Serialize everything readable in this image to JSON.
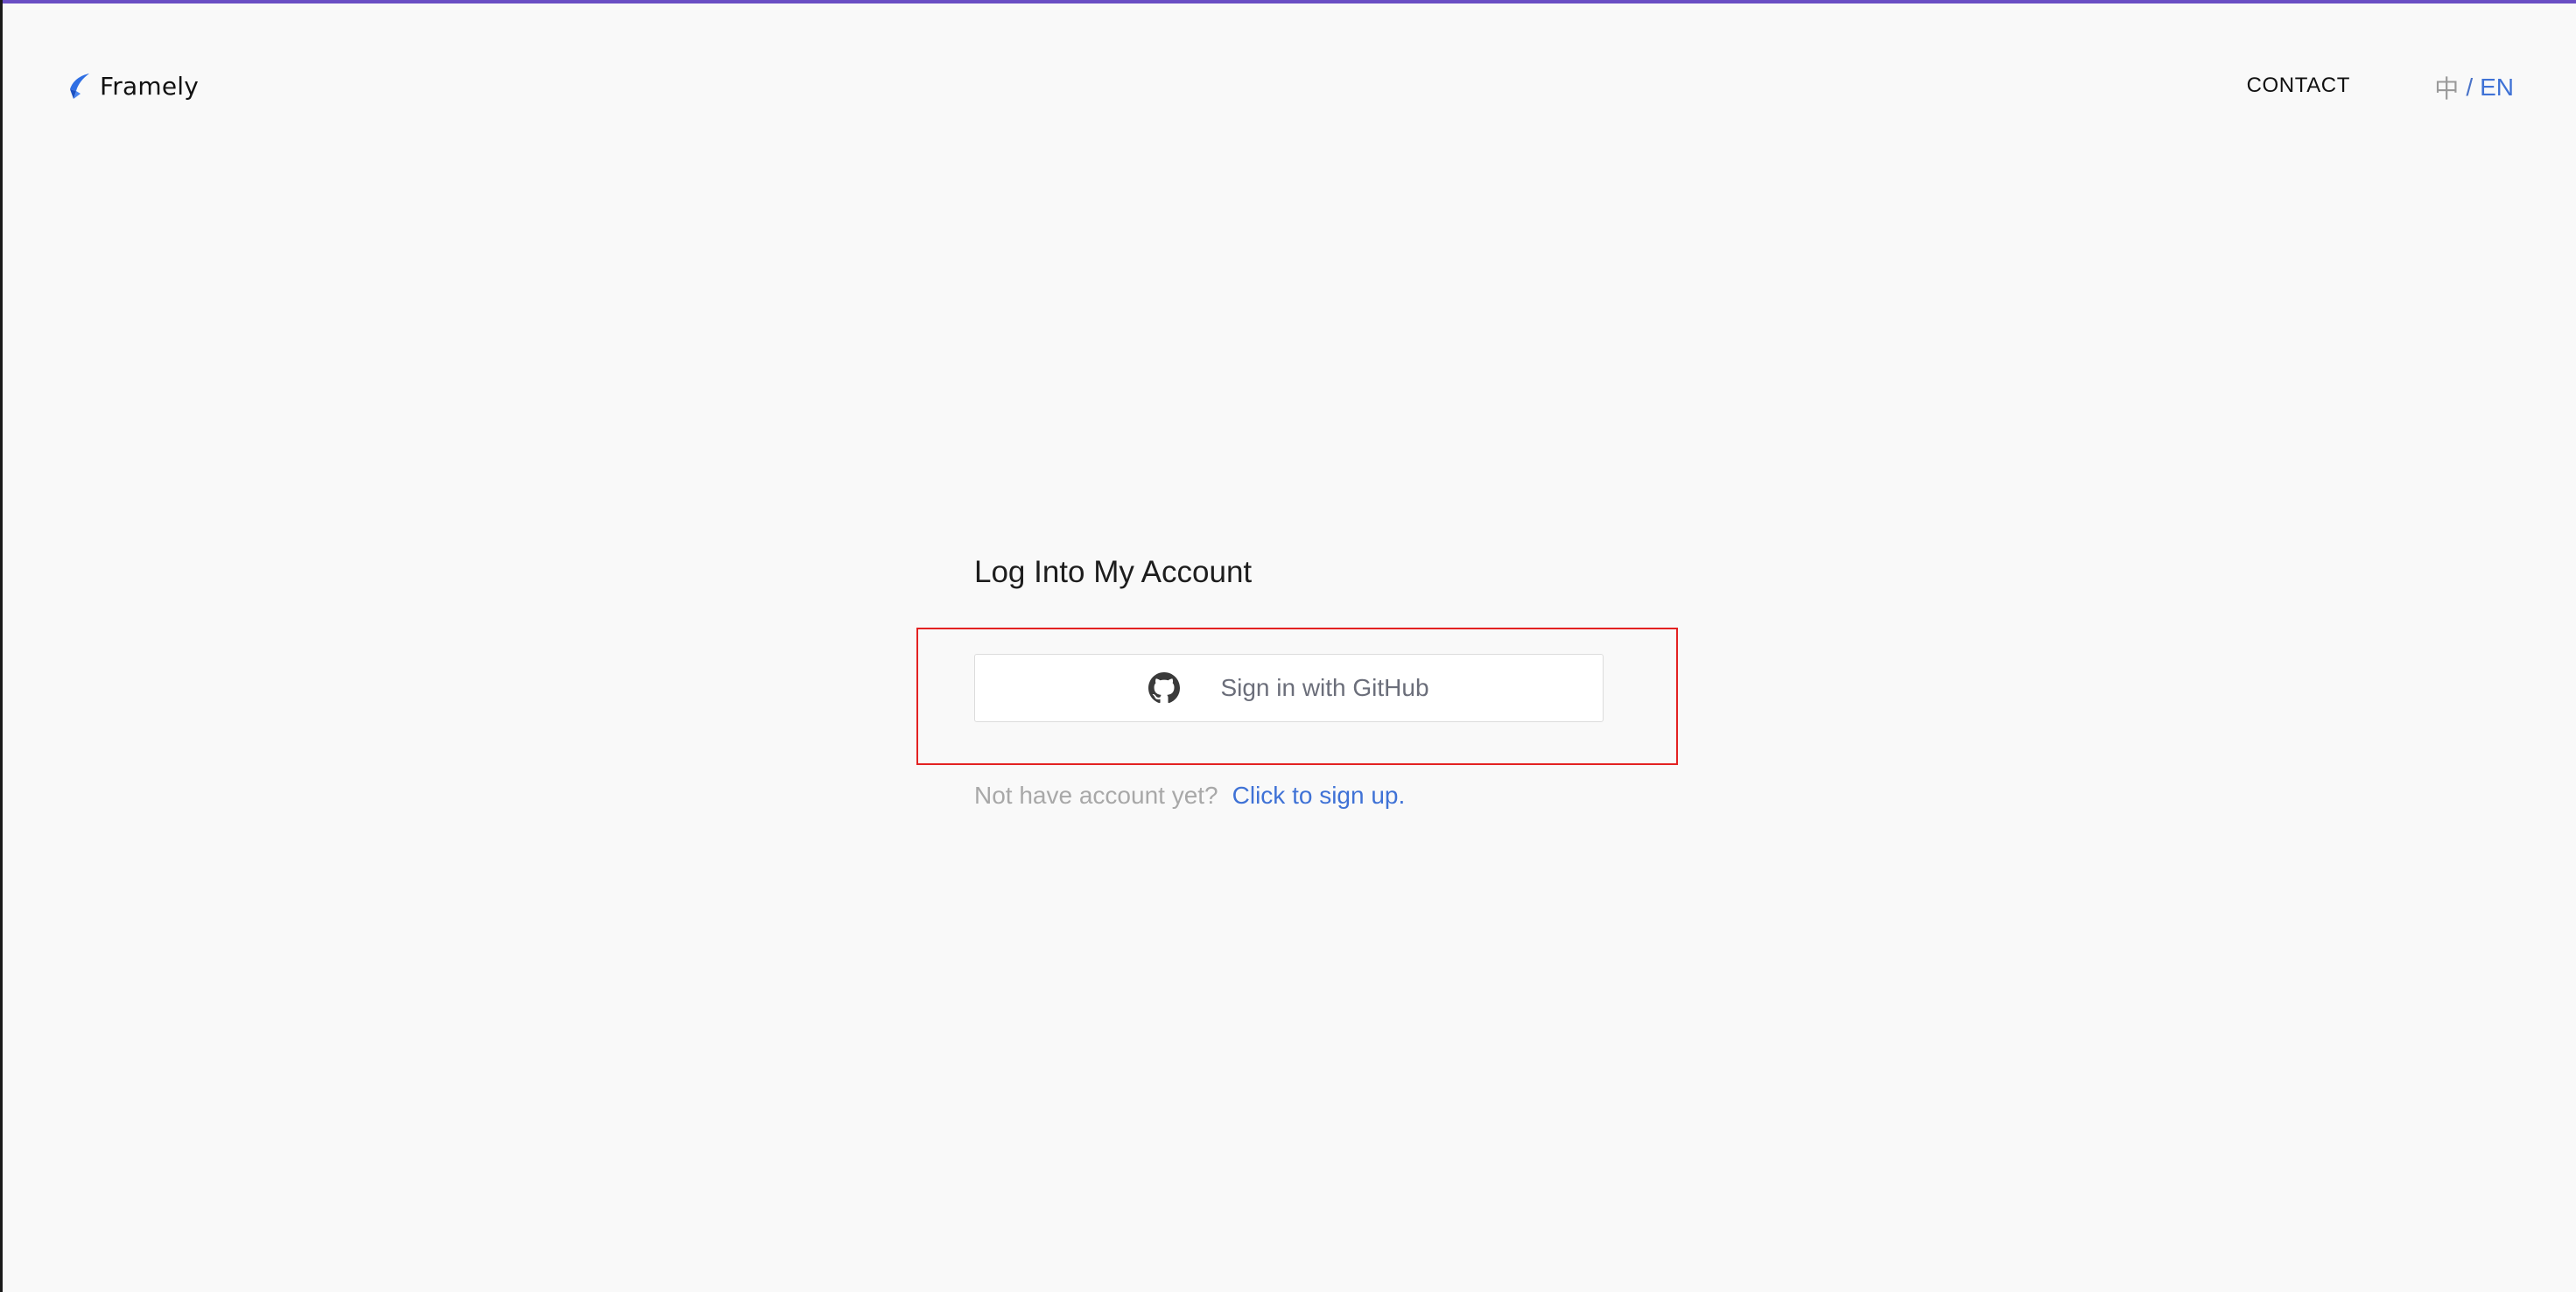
{
  "colors": {
    "accent": "#3f72d6",
    "top_bar": "#6a4fc4",
    "highlight": "#e32222",
    "background": "#f9f9f9"
  },
  "header": {
    "brand_name": "Framely",
    "brand_icon": "feather-logo-icon",
    "contact_label": "CONTACT",
    "lang": {
      "zh": "中",
      "separator": "/",
      "en": "EN",
      "active": "EN"
    }
  },
  "login": {
    "title": "Log Into My Account",
    "github_button_label": "Sign in with GitHub",
    "github_icon": "github-icon",
    "signup_hint": "Not have account yet?",
    "signup_link": "Click to sign up."
  }
}
